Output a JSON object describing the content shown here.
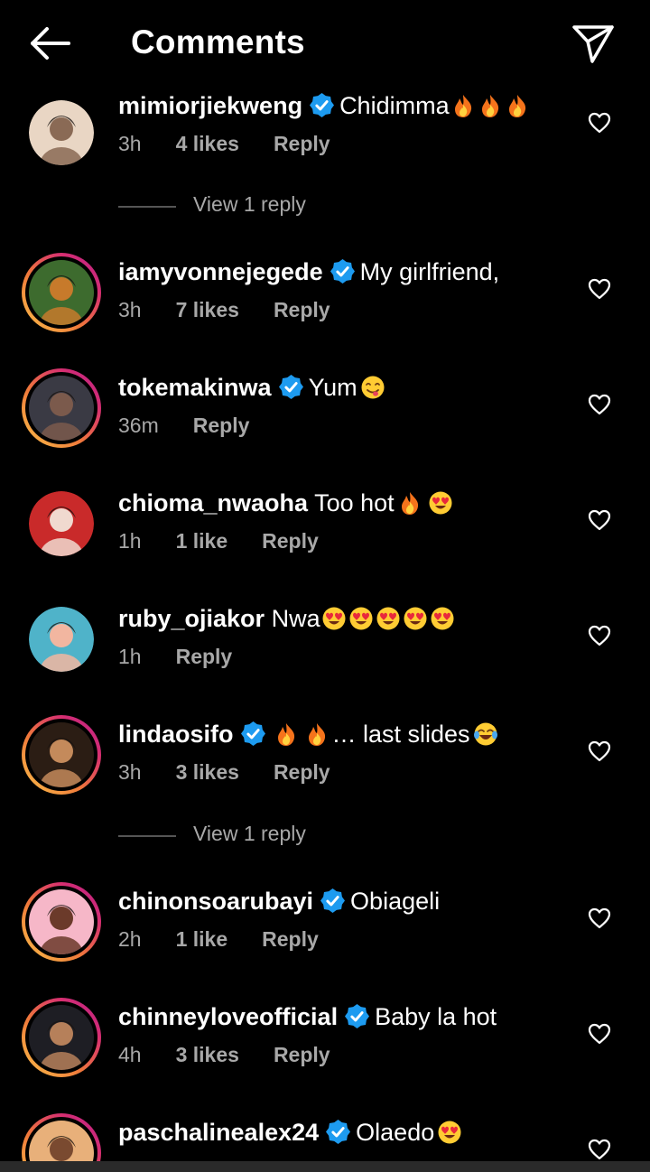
{
  "header": {
    "title": "Comments",
    "back_icon": "arrow-left-icon",
    "share_icon": "paper-plane-icon"
  },
  "colors": {
    "background": "#000000",
    "text_primary": "#ffffff",
    "text_secondary": "#a8a8a8",
    "verified_blue": "#1d9bf0",
    "story_ring_start": "#f9c24a",
    "story_ring_end": "#b51f8c"
  },
  "comments": [
    {
      "username": "mimiorjiekweng",
      "verified": true,
      "text": "Chidimma",
      "emojis": [
        "fire",
        "fire",
        "fire"
      ],
      "time": "3h",
      "likes": "4 likes",
      "reply": "Reply",
      "story_ring": false,
      "view_replies": "View 1 reply"
    },
    {
      "username": "iamyvonnejegede",
      "verified": true,
      "text": "My girlfriend,",
      "emojis": [],
      "time": "3h",
      "likes": "7 likes",
      "reply": "Reply",
      "story_ring": true
    },
    {
      "username": "tokemakinwa",
      "verified": true,
      "text": "Yum",
      "emojis": [
        "face-savoring-food"
      ],
      "time": "36m",
      "likes": "",
      "reply": "Reply",
      "story_ring": true
    },
    {
      "username": "chioma_nwaoha",
      "verified": false,
      "text": "Too hot",
      "emojis": [
        "fire",
        "heart-eyes"
      ],
      "time": "1h",
      "likes": "1 like",
      "reply": "Reply",
      "story_ring": false
    },
    {
      "username": "ruby_ojiakor",
      "verified": false,
      "text": "Nwa",
      "emojis": [
        "heart-eyes",
        "heart-eyes",
        "heart-eyes",
        "heart-eyes",
        "heart-eyes"
      ],
      "time": "1h",
      "likes": "",
      "reply": "Reply",
      "story_ring": false
    },
    {
      "username": "lindaosifo",
      "verified": true,
      "text": "… last slides",
      "emojis_before": [
        "fire",
        "fire"
      ],
      "emojis": [
        "tears-of-joy"
      ],
      "time": "3h",
      "likes": "3 likes",
      "reply": "Reply",
      "story_ring": true,
      "view_replies": "View 1 reply"
    },
    {
      "username": "chinonsoarubayi",
      "verified": true,
      "text": "Obiageli",
      "emojis": [],
      "time": "2h",
      "likes": "1 like",
      "reply": "Reply",
      "story_ring": true
    },
    {
      "username": "chinneyloveofficial",
      "verified": true,
      "text": "Baby la hot",
      "emojis": [],
      "time": "4h",
      "likes": "3 likes",
      "reply": "Reply",
      "story_ring": true
    },
    {
      "username": "paschalinealex24",
      "verified": true,
      "text": "Olaedo",
      "emojis": [
        "heart-eyes"
      ],
      "time": "",
      "likes": "",
      "reply": "",
      "story_ring": true
    }
  ]
}
